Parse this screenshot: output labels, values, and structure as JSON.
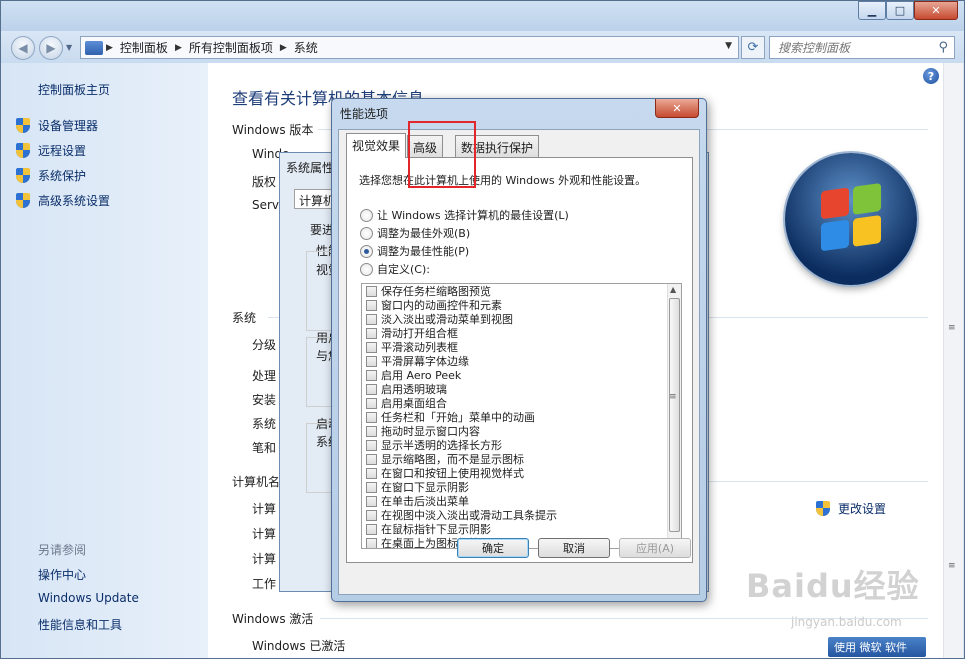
{
  "window": {
    "search_placeholder": "搜索控制面板",
    "breadcrumb": [
      "控制面板",
      "所有控制面板项",
      "系统"
    ]
  },
  "sidebar": {
    "home": "控制面板主页",
    "items": [
      {
        "label": "设备管理器",
        "icon": "shield-icon"
      },
      {
        "label": "远程设置",
        "icon": "shield-icon"
      },
      {
        "label": "系统保护",
        "icon": "shield-icon"
      },
      {
        "label": "高级系统设置",
        "icon": "shield-icon"
      }
    ],
    "see_also": "另请参阅",
    "links": [
      "操作中心",
      "Windows Update",
      "性能信息和工具"
    ]
  },
  "content": {
    "title": "查看有关计算机的基本信息",
    "edition_head": "Windows 版本",
    "edition_rows": [
      "Windo",
      "版权",
      "Serv"
    ],
    "system_head": "系统",
    "system_rows": [
      "分级",
      "处理",
      "安装",
      "系统",
      "笔和"
    ],
    "computer_head": "计算机名",
    "computer_rows": [
      "计算",
      "计算",
      "计算",
      "工作"
    ],
    "activation_head": "Windows 激活",
    "activation_status": "Windows 已激活",
    "change_settings": "更改设置",
    "ms_badge": "使用 微软 软件"
  },
  "sysprops": {
    "title": "系统属性",
    "tab": "计算机",
    "texts": [
      "要进",
      "性能",
      "视觉",
      "用户",
      "与您",
      "启动",
      "系统"
    ]
  },
  "perf": {
    "title": "性能选项",
    "tabs": [
      "视觉效果",
      "高级",
      "数据执行保护"
    ],
    "active_tab": "视觉效果",
    "description": "选择您想在此计算机上使用的 Windows 外观和性能设置。",
    "radios": [
      {
        "label": "让 Windows 选择计算机的最佳设置(L)",
        "checked": false
      },
      {
        "label": "调整为最佳外观(B)",
        "checked": false
      },
      {
        "label": "调整为最佳性能(P)",
        "checked": true
      },
      {
        "label": "自定义(C):",
        "checked": false
      }
    ],
    "options": [
      "保存任务栏缩略图预览",
      "窗口内的动画控件和元素",
      "淡入淡出或滑动菜单到视图",
      "滑动打开组合框",
      "平滑滚动列表框",
      "平滑屏幕字体边缘",
      "启用 Aero Peek",
      "启用透明玻璃",
      "启用桌面组合",
      "任务栏和「开始」菜单中的动画",
      "拖动时显示窗口内容",
      "显示半透明的选择长方形",
      "显示缩略图，而不是显示图标",
      "在窗口和按钮上使用视觉样式",
      "在窗口下显示阴影",
      "在单击后淡出菜单",
      "在视图中淡入淡出或滑动工具条提示",
      "在鼠标指针下显示阴影",
      "在桌面上为图标标签使用阴影"
    ],
    "ok": "确定",
    "cancel": "取消",
    "apply": "应用(A)",
    "highlight_color": "#e3262b"
  },
  "watermark": {
    "main": "Baidu经验",
    "sub": "jingyan.baidu.com"
  }
}
